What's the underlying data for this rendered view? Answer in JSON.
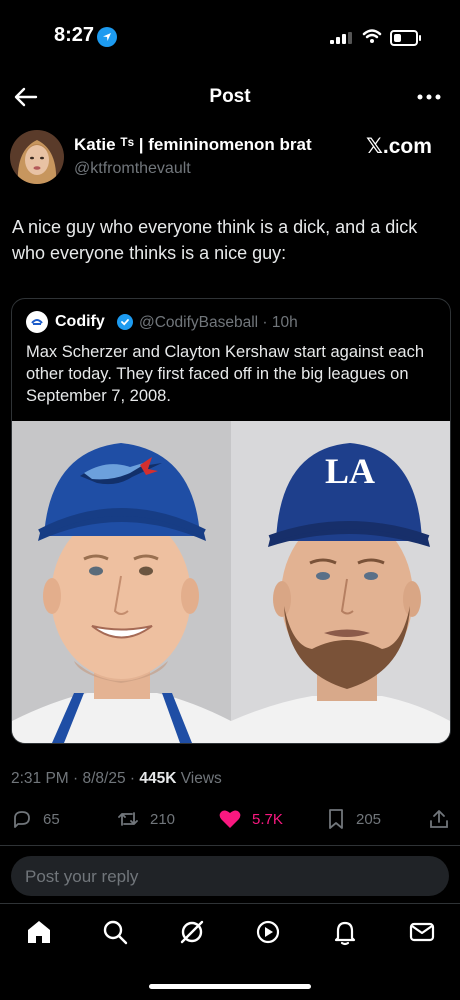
{
  "status": {
    "time": "8:27",
    "battery_level": 0.35
  },
  "header": {
    "title": "Post"
  },
  "author": {
    "name": "Katie ᵀˢ | femininomenon brat",
    "handle": "@ktfromthevault",
    "source": "𝕏.com"
  },
  "tweet": {
    "text": "A nice guy who everyone think is a dick, and a dick who everyone thinks is a nice guy:"
  },
  "quote": {
    "name": "Codify",
    "handle_time": "@CodifyBaseball · 10h",
    "text": "Max Scherzer and Clayton Kershaw start against each other today.  They first faced off in the big leagues on September 7, 2008.",
    "left_cap_logo": "blue-jays-logo",
    "right_cap_logo": "LA"
  },
  "meta": {
    "time_date": "2:31 PM · 8/8/25 · ",
    "views_count": "445K",
    "views_label": " Views"
  },
  "actions": {
    "replies": "65",
    "reposts": "210",
    "likes": "5.7K",
    "bookmarks": "205"
  },
  "colors": {
    "accent": "#1d9bf0",
    "like": "#f91880",
    "background": "#000000"
  },
  "reply": {
    "placeholder": "Post your reply"
  },
  "nav": [
    "home-icon",
    "search-icon",
    "grok-icon",
    "video-icon",
    "notifications-icon",
    "messages-icon"
  ]
}
